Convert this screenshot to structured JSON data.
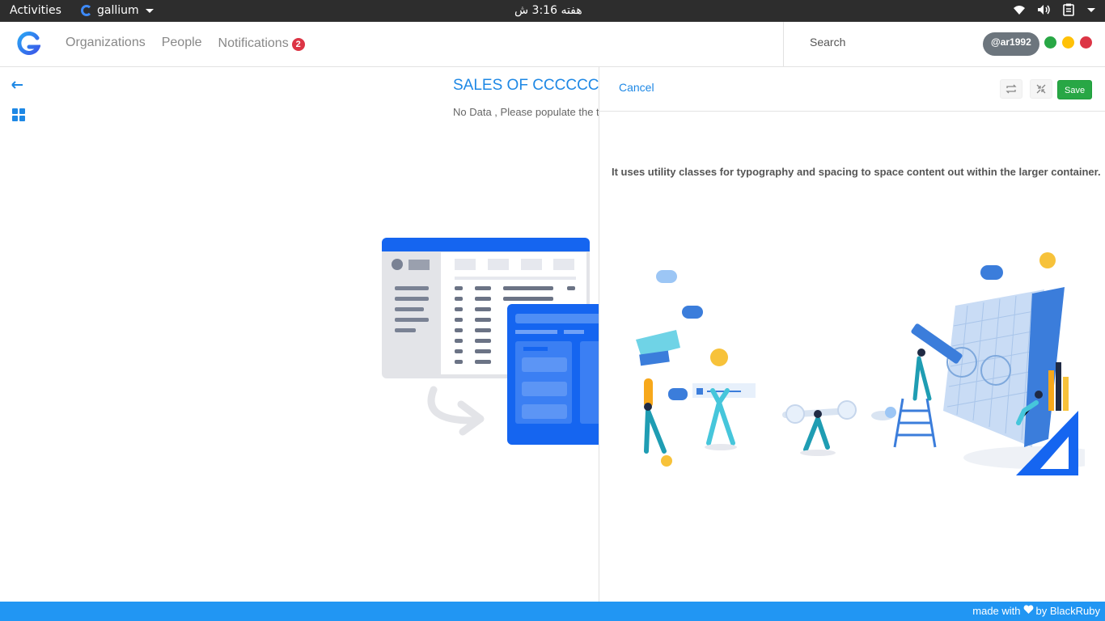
{
  "topbar": {
    "activities": "Activities",
    "app_name": "gallium",
    "clock": "هفته 3:16 ش",
    "icons": [
      "wifi-icon",
      "volume-icon",
      "clipboard-icon",
      "system-menu-caret-icon"
    ]
  },
  "navbar": {
    "logo": "G",
    "nav_items": [
      "Organizations",
      "People",
      "Notifications"
    ],
    "notifications_count": "2",
    "search_placeholder": "Search",
    "username": "@ar1992",
    "status_dots": [
      "#28a745",
      "#ffc107",
      "#dc3545"
    ]
  },
  "sidebar": {
    "icons": [
      "arrow-left-icon",
      "grid-icon"
    ]
  },
  "main": {
    "title": "SALES OF CCCCCC",
    "message": "No Data , Please populate the ta"
  },
  "panel": {
    "cancel_label": "Cancel",
    "save_label": "Save",
    "icon_buttons": [
      "repeat-icon",
      "shrink-icon"
    ],
    "lead_text": "It uses utility classes for typography and spacing to space content out within the larger container."
  },
  "footer": {
    "prefix": "made with",
    "suffix": "by BlackRuby"
  },
  "colors": {
    "accent": "#1e88e5",
    "save_green": "#28a745",
    "footer_blue": "#2196f3"
  }
}
